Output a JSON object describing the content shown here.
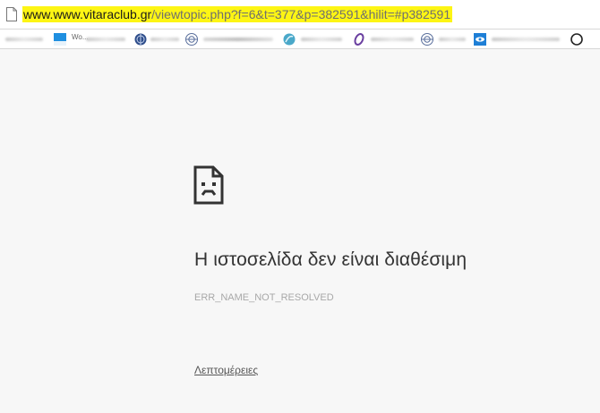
{
  "address_bar": {
    "url_host": "www.www.vitaraclub.gr",
    "url_path": "/viewtopic.php?f=6&t=377&p=382591&hilit=#p382591",
    "highlight_color": "#fdf514"
  },
  "bookmarks": [
    {
      "icon": "blurred-favicon"
    },
    {
      "icon": "blue-square-favicon",
      "text": "Wo..."
    },
    {
      "icon": "globe-favicon"
    },
    {
      "icon": "globe-favicon"
    },
    {
      "icon": "teal-swirl-favicon"
    },
    {
      "icon": "purple-swirl-favicon"
    },
    {
      "icon": "globe-favicon"
    },
    {
      "icon": "blue-eye-favicon"
    },
    {
      "icon": "circle-favicon"
    }
  ],
  "error_page": {
    "icon": "sad-page-icon",
    "title": "Η ιστοσελίδα δεν είναι διαθέσιμη",
    "code": "ERR_NAME_NOT_RESOLVED",
    "details_link": "Λεπτομέρειες"
  }
}
